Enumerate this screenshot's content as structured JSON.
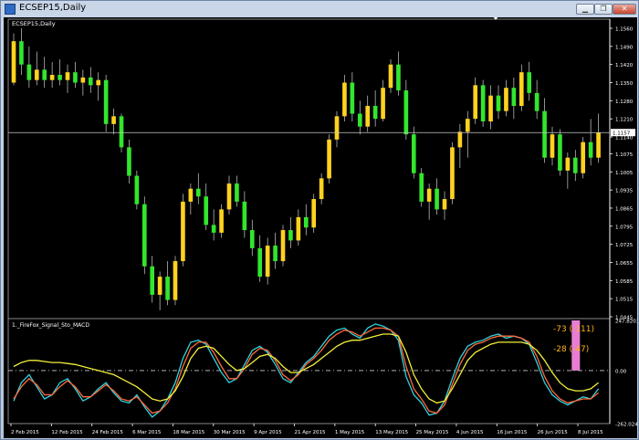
{
  "window": {
    "title": "ECSEP15,Daily",
    "buttons": {
      "minimize": "▁",
      "restore": "❐",
      "close": "✕"
    }
  },
  "chart_data": [
    {
      "type": "candlestick",
      "title": "ECSEP15,Daily",
      "colors": {
        "bull": "#ffd21e",
        "bear": "#32e62d",
        "wick": "#cfcfcf",
        "price_line": "#c8c8c8",
        "grid": "none",
        "background": "#000000"
      },
      "y_ticks": [
        "1.1560",
        "1.1490",
        "1.1420",
        "1.1350",
        "1.1280",
        "1.1210",
        "1.1140",
        "1.1075",
        "1.1005",
        "1.0935",
        "1.0865",
        "1.0795",
        "1.0725",
        "1.0655",
        "1.0585",
        "1.0515",
        "1.0445"
      ],
      "ylim": [
        1.0445,
        1.156
      ],
      "current_price": "1.1157",
      "candles": [
        {
          "o": 1.135,
          "h": 1.154,
          "l": 1.134,
          "c": 1.151
        },
        {
          "o": 1.151,
          "h": 1.156,
          "l": 1.138,
          "c": 1.142
        },
        {
          "o": 1.142,
          "h": 1.149,
          "l": 1.133,
          "c": 1.136
        },
        {
          "o": 1.136,
          "h": 1.147,
          "l": 1.134,
          "c": 1.14
        },
        {
          "o": 1.14,
          "h": 1.145,
          "l": 1.133,
          "c": 1.136
        },
        {
          "o": 1.136,
          "h": 1.143,
          "l": 1.133,
          "c": 1.138
        },
        {
          "o": 1.138,
          "h": 1.144,
          "l": 1.134,
          "c": 1.136
        },
        {
          "o": 1.136,
          "h": 1.142,
          "l": 1.131,
          "c": 1.139
        },
        {
          "o": 1.139,
          "h": 1.143,
          "l": 1.133,
          "c": 1.135
        },
        {
          "o": 1.135,
          "h": 1.14,
          "l": 1.13,
          "c": 1.137
        },
        {
          "o": 1.137,
          "h": 1.141,
          "l": 1.131,
          "c": 1.134
        },
        {
          "o": 1.134,
          "h": 1.139,
          "l": 1.128,
          "c": 1.136
        },
        {
          "o": 1.136,
          "h": 1.138,
          "l": 1.116,
          "c": 1.119
        },
        {
          "o": 1.119,
          "h": 1.125,
          "l": 1.115,
          "c": 1.122
        },
        {
          "o": 1.122,
          "h": 1.123,
          "l": 1.108,
          "c": 1.11
        },
        {
          "o": 1.11,
          "h": 1.113,
          "l": 1.096,
          "c": 1.099
        },
        {
          "o": 1.099,
          "h": 1.101,
          "l": 1.086,
          "c": 1.088
        },
        {
          "o": 1.088,
          "h": 1.091,
          "l": 1.061,
          "c": 1.064
        },
        {
          "o": 1.064,
          "h": 1.068,
          "l": 1.05,
          "c": 1.053
        },
        {
          "o": 1.053,
          "h": 1.062,
          "l": 1.047,
          "c": 1.06
        },
        {
          "o": 1.06,
          "h": 1.066,
          "l": 1.049,
          "c": 1.051
        },
        {
          "o": 1.051,
          "h": 1.068,
          "l": 1.049,
          "c": 1.066
        },
        {
          "o": 1.066,
          "h": 1.092,
          "l": 1.064,
          "c": 1.089
        },
        {
          "o": 1.089,
          "h": 1.096,
          "l": 1.084,
          "c": 1.094
        },
        {
          "o": 1.094,
          "h": 1.1,
          "l": 1.088,
          "c": 1.091
        },
        {
          "o": 1.091,
          "h": 1.096,
          "l": 1.078,
          "c": 1.08
        },
        {
          "o": 1.08,
          "h": 1.086,
          "l": 1.074,
          "c": 1.077
        },
        {
          "o": 1.077,
          "h": 1.088,
          "l": 1.075,
          "c": 1.086
        },
        {
          "o": 1.086,
          "h": 1.099,
          "l": 1.084,
          "c": 1.096
        },
        {
          "o": 1.096,
          "h": 1.099,
          "l": 1.087,
          "c": 1.089
        },
        {
          "o": 1.089,
          "h": 1.093,
          "l": 1.075,
          "c": 1.078
        },
        {
          "o": 1.078,
          "h": 1.082,
          "l": 1.068,
          "c": 1.071
        },
        {
          "o": 1.071,
          "h": 1.076,
          "l": 1.058,
          "c": 1.06
        },
        {
          "o": 1.06,
          "h": 1.075,
          "l": 1.057,
          "c": 1.072
        },
        {
          "o": 1.072,
          "h": 1.077,
          "l": 1.063,
          "c": 1.066
        },
        {
          "o": 1.066,
          "h": 1.08,
          "l": 1.064,
          "c": 1.078
        },
        {
          "o": 1.078,
          "h": 1.083,
          "l": 1.071,
          "c": 1.074
        },
        {
          "o": 1.074,
          "h": 1.086,
          "l": 1.072,
          "c": 1.083
        },
        {
          "o": 1.083,
          "h": 1.088,
          "l": 1.076,
          "c": 1.079
        },
        {
          "o": 1.079,
          "h": 1.092,
          "l": 1.077,
          "c": 1.09
        },
        {
          "o": 1.09,
          "h": 1.1,
          "l": 1.088,
          "c": 1.098
        },
        {
          "o": 1.098,
          "h": 1.115,
          "l": 1.096,
          "c": 1.113
        },
        {
          "o": 1.113,
          "h": 1.124,
          "l": 1.11,
          "c": 1.122
        },
        {
          "o": 1.122,
          "h": 1.138,
          "l": 1.12,
          "c": 1.135
        },
        {
          "o": 1.135,
          "h": 1.139,
          "l": 1.12,
          "c": 1.123
        },
        {
          "o": 1.123,
          "h": 1.128,
          "l": 1.115,
          "c": 1.118
        },
        {
          "o": 1.118,
          "h": 1.13,
          "l": 1.116,
          "c": 1.126
        },
        {
          "o": 1.126,
          "h": 1.132,
          "l": 1.118,
          "c": 1.121
        },
        {
          "o": 1.121,
          "h": 1.136,
          "l": 1.12,
          "c": 1.133
        },
        {
          "o": 1.133,
          "h": 1.144,
          "l": 1.131,
          "c": 1.142
        },
        {
          "o": 1.142,
          "h": 1.147,
          "l": 1.13,
          "c": 1.132
        },
        {
          "o": 1.132,
          "h": 1.136,
          "l": 1.113,
          "c": 1.115
        },
        {
          "o": 1.115,
          "h": 1.118,
          "l": 1.098,
          "c": 1.1
        },
        {
          "o": 1.1,
          "h": 1.102,
          "l": 1.087,
          "c": 1.089
        },
        {
          "o": 1.089,
          "h": 1.096,
          "l": 1.082,
          "c": 1.094
        },
        {
          "o": 1.094,
          "h": 1.098,
          "l": 1.084,
          "c": 1.086
        },
        {
          "o": 1.086,
          "h": 1.093,
          "l": 1.082,
          "c": 1.09
        },
        {
          "o": 1.09,
          "h": 1.112,
          "l": 1.088,
          "c": 1.11
        },
        {
          "o": 1.11,
          "h": 1.119,
          "l": 1.102,
          "c": 1.116
        },
        {
          "o": 1.116,
          "h": 1.124,
          "l": 1.106,
          "c": 1.121
        },
        {
          "o": 1.121,
          "h": 1.137,
          "l": 1.119,
          "c": 1.134
        },
        {
          "o": 1.134,
          "h": 1.136,
          "l": 1.118,
          "c": 1.12
        },
        {
          "o": 1.12,
          "h": 1.134,
          "l": 1.117,
          "c": 1.13
        },
        {
          "o": 1.13,
          "h": 1.134,
          "l": 1.121,
          "c": 1.124
        },
        {
          "o": 1.124,
          "h": 1.136,
          "l": 1.122,
          "c": 1.133
        },
        {
          "o": 1.133,
          "h": 1.137,
          "l": 1.121,
          "c": 1.126
        },
        {
          "o": 1.126,
          "h": 1.142,
          "l": 1.124,
          "c": 1.139
        },
        {
          "o": 1.139,
          "h": 1.143,
          "l": 1.128,
          "c": 1.131
        },
        {
          "o": 1.131,
          "h": 1.136,
          "l": 1.121,
          "c": 1.124
        },
        {
          "o": 1.124,
          "h": 1.129,
          "l": 1.104,
          "c": 1.106
        },
        {
          "o": 1.106,
          "h": 1.118,
          "l": 1.103,
          "c": 1.115
        },
        {
          "o": 1.115,
          "h": 1.117,
          "l": 1.099,
          "c": 1.101
        },
        {
          "o": 1.101,
          "h": 1.108,
          "l": 1.094,
          "c": 1.106
        },
        {
          "o": 1.106,
          "h": 1.109,
          "l": 1.097,
          "c": 1.1
        },
        {
          "o": 1.1,
          "h": 1.114,
          "l": 1.098,
          "c": 1.112
        },
        {
          "o": 1.112,
          "h": 1.121,
          "l": 1.103,
          "c": 1.106
        },
        {
          "o": 1.106,
          "h": 1.123,
          "l": 1.104,
          "c": 1.1157
        }
      ],
      "indicator": {
        "label": "1._FireFox_Signal_Sto_MACD",
        "y_ticks": [
          "247.8203",
          "0.00",
          "-262.0245"
        ],
        "ylim": [
          -262.0245,
          247.8203
        ],
        "readouts": [
          {
            "text": "-73  (-111)",
            "color": "#ffb31a"
          },
          {
            "text": "-28  (-47)",
            "color": "#ffb31a"
          }
        ],
        "series": [
          {
            "color": "#2fd3df",
            "values": [
              -150,
              -60,
              -20,
              -80,
              -140,
              -120,
              -60,
              -40,
              -90,
              -150,
              -130,
              -90,
              -60,
              -110,
              -150,
              -160,
              -120,
              -180,
              -230,
              -200,
              -140,
              -60,
              60,
              140,
              150,
              130,
              60,
              -10,
              -60,
              -40,
              30,
              100,
              120,
              90,
              30,
              -40,
              -60,
              -10,
              40,
              70,
              120,
              170,
              200,
              210,
              180,
              160,
              210,
              230,
              220,
              200,
              150,
              -30,
              -120,
              -160,
              -220,
              -210,
              -150,
              -40,
              60,
              120,
              140,
              150,
              170,
              180,
              160,
              170,
              160,
              130,
              40,
              -60,
              -120,
              -150,
              -170,
              -150,
              -130,
              -140,
              -90
            ]
          },
          {
            "color": "#ff6a3d",
            "values": [
              -140,
              -80,
              -40,
              -70,
              -120,
              -120,
              -80,
              -50,
              -80,
              -130,
              -130,
              -100,
              -70,
              -100,
              -140,
              -150,
              -130,
              -170,
              -210,
              -200,
              -160,
              -90,
              20,
              110,
              140,
              140,
              90,
              20,
              -40,
              -40,
              10,
              80,
              110,
              100,
              50,
              -20,
              -50,
              -20,
              30,
              60,
              100,
              150,
              180,
              200,
              190,
              170,
              190,
              210,
              210,
              200,
              170,
              20,
              -90,
              -140,
              -200,
              -210,
              -170,
              -70,
              30,
              100,
              130,
              140,
              160,
              170,
              170,
              170,
              160,
              140,
              70,
              -30,
              -100,
              -140,
              -160,
              -150,
              -140,
              -140,
              -110
            ]
          },
          {
            "color": "#f2ef38",
            "values": [
              20,
              40,
              50,
              50,
              45,
              40,
              40,
              35,
              30,
              20,
              10,
              0,
              -10,
              -20,
              -40,
              -60,
              -80,
              -110,
              -140,
              -150,
              -140,
              -100,
              -30,
              60,
              110,
              120,
              110,
              70,
              30,
              0,
              10,
              40,
              70,
              80,
              60,
              20,
              -10,
              -10,
              10,
              30,
              60,
              90,
              120,
              140,
              150,
              150,
              160,
              170,
              180,
              180,
              170,
              90,
              -20,
              -90,
              -140,
              -160,
              -150,
              -90,
              -20,
              50,
              90,
              110,
              130,
              140,
              140,
              140,
              140,
              130,
              100,
              50,
              -10,
              -60,
              -90,
              -100,
              -100,
              -90,
              -60
            ]
          }
        ],
        "histogram_last_value": 247.8203,
        "histogram_color": "#e77ed3",
        "signal_level": 0
      },
      "x_ticks": [
        "2 Feb 2015",
        "12 Feb 2015",
        "24 Feb 2015",
        "6 Mar 2015",
        "18 Mar 2015",
        "30 Mar 2015",
        "9 Apr 2015",
        "21 Apr 2015",
        "1 May 2015",
        "13 May 2015",
        "25 May 2015",
        "4 Jun 2015",
        "16 Jun 2015",
        "26 Jun 2015",
        "8 Jul 2015"
      ]
    }
  ]
}
